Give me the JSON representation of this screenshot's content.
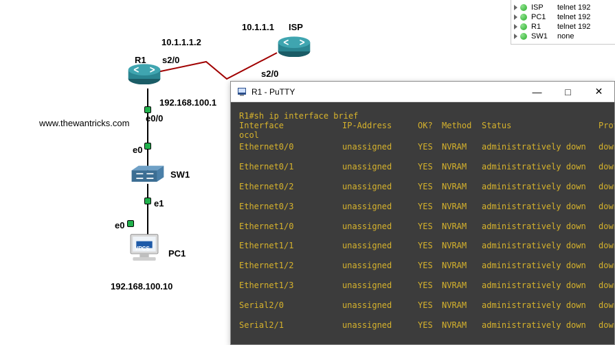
{
  "topology": {
    "isp_ip": "10.1.1.1",
    "isp_label": "ISP",
    "r1_serial_ip": "10.1.1.1.2",
    "r1_label": "R1",
    "r1_serial_port": "s2/0",
    "isp_serial_port": "s2/0",
    "r1_lan_ip": "192.168.100.1",
    "r1_eth_port": "e0/0",
    "sw1_up_port": "e0",
    "sw1_label": "SW1",
    "sw1_down_port": "e1",
    "pc1_port": "e0",
    "pc1_label": "PC1",
    "pc1_ip": "192.168.100.10",
    "watermark": "www.thewantricks.com",
    "vpcs_badge": "VPCS"
  },
  "device_panel": [
    {
      "name": "ISP",
      "conn": "telnet 192"
    },
    {
      "name": "PC1",
      "conn": "telnet 192"
    },
    {
      "name": "R1",
      "conn": "telnet 192"
    },
    {
      "name": "SW1",
      "conn": "none"
    }
  ],
  "putty": {
    "title": "R1 - PuTTY",
    "minimize": "—",
    "maximize": "□",
    "close": "✕",
    "prompt": "R1#sh ip interface brief",
    "header": {
      "iface": "Interface",
      "ip": "IP-Address",
      "ok": "OK?",
      "method": "Method",
      "status": "Status",
      "proto": "Prot"
    },
    "ocol": "ocol",
    "rows": [
      {
        "iface": "Ethernet0/0",
        "ip": "unassigned",
        "ok": "YES",
        "method": "NVRAM",
        "status": "administratively down",
        "proto": "down"
      },
      {
        "iface": "Ethernet0/1",
        "ip": "unassigned",
        "ok": "YES",
        "method": "NVRAM",
        "status": "administratively down",
        "proto": "down"
      },
      {
        "iface": "Ethernet0/2",
        "ip": "unassigned",
        "ok": "YES",
        "method": "NVRAM",
        "status": "administratively down",
        "proto": "down"
      },
      {
        "iface": "Ethernet0/3",
        "ip": "unassigned",
        "ok": "YES",
        "method": "NVRAM",
        "status": "administratively down",
        "proto": "down"
      },
      {
        "iface": "Ethernet1/0",
        "ip": "unassigned",
        "ok": "YES",
        "method": "NVRAM",
        "status": "administratively down",
        "proto": "down"
      },
      {
        "iface": "Ethernet1/1",
        "ip": "unassigned",
        "ok": "YES",
        "method": "NVRAM",
        "status": "administratively down",
        "proto": "down"
      },
      {
        "iface": "Ethernet1/2",
        "ip": "unassigned",
        "ok": "YES",
        "method": "NVRAM",
        "status": "administratively down",
        "proto": "down"
      },
      {
        "iface": "Ethernet1/3",
        "ip": "unassigned",
        "ok": "YES",
        "method": "NVRAM",
        "status": "administratively down",
        "proto": "down"
      },
      {
        "iface": "Serial2/0",
        "ip": "unassigned",
        "ok": "YES",
        "method": "NVRAM",
        "status": "administratively down",
        "proto": "down"
      },
      {
        "iface": "Serial2/1",
        "ip": "unassigned",
        "ok": "YES",
        "method": "NVRAM",
        "status": "administratively down",
        "proto": "down"
      }
    ]
  }
}
